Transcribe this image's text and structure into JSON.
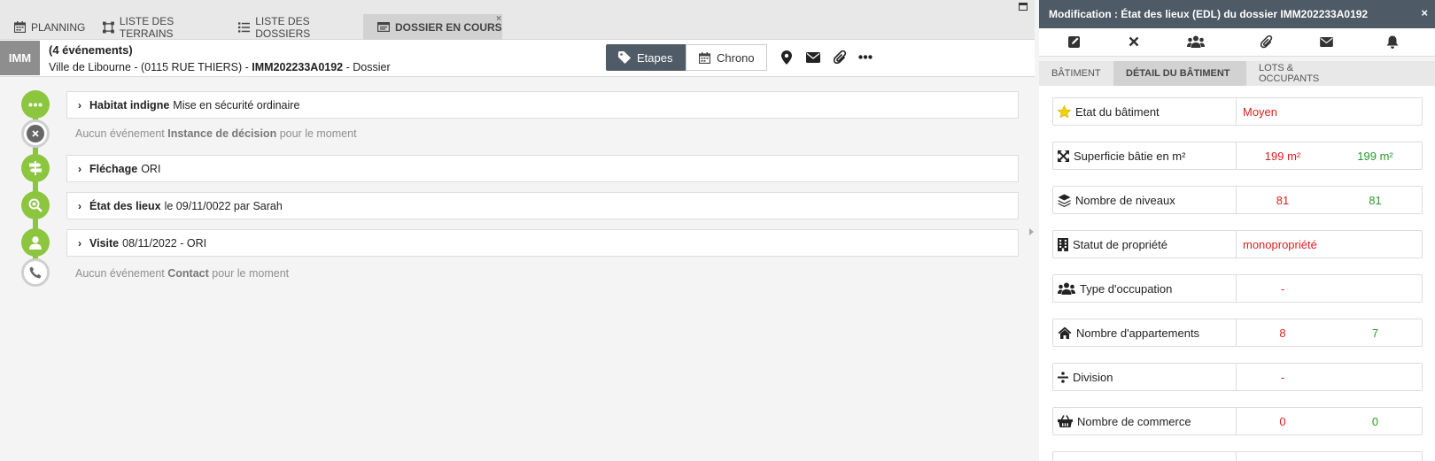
{
  "tabs": [
    {
      "label": "PLANNING",
      "icon": "calendar-icon"
    },
    {
      "label": "LISTE DES TERRAINS",
      "icon": "area-icon"
    },
    {
      "label": "LISTE DES DOSSIERS",
      "icon": "list-icon"
    },
    {
      "label": "DOSSIER EN COURS",
      "icon": "window-icon",
      "active": true,
      "close": "×"
    }
  ],
  "header": {
    "badge": "IMM",
    "count": "(4 événements)",
    "address_prefix": "Ville de Libourne - (0115 RUE THIERS) - ",
    "dossier_id": "IMM202233A0192",
    "address_suffix": " - Dossier",
    "etapes_label": "Etapes",
    "chrono_label": "Chrono"
  },
  "timeline": [
    {
      "type": "event",
      "icon": "ellipsis-icon",
      "title": "Habitat indigne",
      "detail": "Mise en sécurité ordinaire"
    },
    {
      "type": "none",
      "icon": "x-circle-icon",
      "prefix": "Aucun événement",
      "name": "Instance de décision",
      "suffix": "pour le moment"
    },
    {
      "type": "event",
      "icon": "signpost-icon",
      "title": "Fléchage",
      "detail": "ORI"
    },
    {
      "type": "event",
      "icon": "search-icon",
      "title": "État des lieux",
      "detail": "le 09/11/0022 par Sarah"
    },
    {
      "type": "event",
      "icon": "user-icon",
      "title": "Visite",
      "detail": "08/11/2022 - ORI"
    },
    {
      "type": "none",
      "icon": "phone-icon",
      "prefix": "Aucun événement",
      "name": "Contact",
      "suffix": "pour le moment"
    }
  ],
  "panel": {
    "title": "Modification : État des lieux (EDL) du dossier IMM202233A0192",
    "close": "×",
    "tabs": [
      "BÂTIMENT",
      "DÉTAIL DU BÂTIMENT",
      "LOTS & OCCUPANTS"
    ],
    "rows": [
      {
        "label": "Etat du bâtiment",
        "icon": "star-icon",
        "v1": "Moyen",
        "v2": ""
      },
      {
        "label": "Superficie bâtie en m²",
        "icon": "expand-icon",
        "v1": "199 m²",
        "v2": "199 m²"
      },
      {
        "label": "Nombre de niveaux",
        "icon": "layers-icon",
        "v1": "81",
        "v2": "81"
      },
      {
        "label": "Statut de propriété",
        "icon": "building-icon",
        "v1": "monopropriété",
        "v2": ""
      },
      {
        "label": "Type d'occupation",
        "icon": "users-icon",
        "v1": "-",
        "v2": ""
      },
      {
        "label": "Nombre d'appartements",
        "icon": "home-icon",
        "v1": "8",
        "v2": "7"
      },
      {
        "label": "Division",
        "icon": "divide-icon",
        "v1": "-",
        "v2": ""
      },
      {
        "label": "Nombre de commerce",
        "icon": "basket-icon",
        "v1": "0",
        "v2": "0"
      }
    ]
  },
  "colors": {
    "accent": "#8cc63f",
    "dark": "#4e5a65",
    "red": "#e01e1e",
    "green": "#2a9a2a"
  }
}
